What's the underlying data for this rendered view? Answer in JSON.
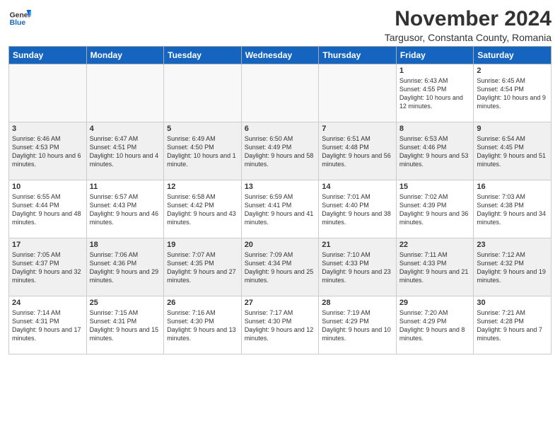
{
  "header": {
    "logo_general": "General",
    "logo_blue": "Blue",
    "month_title": "November 2024",
    "location": "Targusor, Constanta County, Romania"
  },
  "days_of_week": [
    "Sunday",
    "Monday",
    "Tuesday",
    "Wednesday",
    "Thursday",
    "Friday",
    "Saturday"
  ],
  "weeks": [
    [
      {
        "day": "",
        "info": ""
      },
      {
        "day": "",
        "info": ""
      },
      {
        "day": "",
        "info": ""
      },
      {
        "day": "",
        "info": ""
      },
      {
        "day": "",
        "info": ""
      },
      {
        "day": "1",
        "info": "Sunrise: 6:43 AM\nSunset: 4:55 PM\nDaylight: 10 hours and 12 minutes."
      },
      {
        "day": "2",
        "info": "Sunrise: 6:45 AM\nSunset: 4:54 PM\nDaylight: 10 hours and 9 minutes."
      }
    ],
    [
      {
        "day": "3",
        "info": "Sunrise: 6:46 AM\nSunset: 4:53 PM\nDaylight: 10 hours and 6 minutes."
      },
      {
        "day": "4",
        "info": "Sunrise: 6:47 AM\nSunset: 4:51 PM\nDaylight: 10 hours and 4 minutes."
      },
      {
        "day": "5",
        "info": "Sunrise: 6:49 AM\nSunset: 4:50 PM\nDaylight: 10 hours and 1 minute."
      },
      {
        "day": "6",
        "info": "Sunrise: 6:50 AM\nSunset: 4:49 PM\nDaylight: 9 hours and 58 minutes."
      },
      {
        "day": "7",
        "info": "Sunrise: 6:51 AM\nSunset: 4:48 PM\nDaylight: 9 hours and 56 minutes."
      },
      {
        "day": "8",
        "info": "Sunrise: 6:53 AM\nSunset: 4:46 PM\nDaylight: 9 hours and 53 minutes."
      },
      {
        "day": "9",
        "info": "Sunrise: 6:54 AM\nSunset: 4:45 PM\nDaylight: 9 hours and 51 minutes."
      }
    ],
    [
      {
        "day": "10",
        "info": "Sunrise: 6:55 AM\nSunset: 4:44 PM\nDaylight: 9 hours and 48 minutes."
      },
      {
        "day": "11",
        "info": "Sunrise: 6:57 AM\nSunset: 4:43 PM\nDaylight: 9 hours and 46 minutes."
      },
      {
        "day": "12",
        "info": "Sunrise: 6:58 AM\nSunset: 4:42 PM\nDaylight: 9 hours and 43 minutes."
      },
      {
        "day": "13",
        "info": "Sunrise: 6:59 AM\nSunset: 4:41 PM\nDaylight: 9 hours and 41 minutes."
      },
      {
        "day": "14",
        "info": "Sunrise: 7:01 AM\nSunset: 4:40 PM\nDaylight: 9 hours and 38 minutes."
      },
      {
        "day": "15",
        "info": "Sunrise: 7:02 AM\nSunset: 4:39 PM\nDaylight: 9 hours and 36 minutes."
      },
      {
        "day": "16",
        "info": "Sunrise: 7:03 AM\nSunset: 4:38 PM\nDaylight: 9 hours and 34 minutes."
      }
    ],
    [
      {
        "day": "17",
        "info": "Sunrise: 7:05 AM\nSunset: 4:37 PM\nDaylight: 9 hours and 32 minutes."
      },
      {
        "day": "18",
        "info": "Sunrise: 7:06 AM\nSunset: 4:36 PM\nDaylight: 9 hours and 29 minutes."
      },
      {
        "day": "19",
        "info": "Sunrise: 7:07 AM\nSunset: 4:35 PM\nDaylight: 9 hours and 27 minutes."
      },
      {
        "day": "20",
        "info": "Sunrise: 7:09 AM\nSunset: 4:34 PM\nDaylight: 9 hours and 25 minutes."
      },
      {
        "day": "21",
        "info": "Sunrise: 7:10 AM\nSunset: 4:33 PM\nDaylight: 9 hours and 23 minutes."
      },
      {
        "day": "22",
        "info": "Sunrise: 7:11 AM\nSunset: 4:33 PM\nDaylight: 9 hours and 21 minutes."
      },
      {
        "day": "23",
        "info": "Sunrise: 7:12 AM\nSunset: 4:32 PM\nDaylight: 9 hours and 19 minutes."
      }
    ],
    [
      {
        "day": "24",
        "info": "Sunrise: 7:14 AM\nSunset: 4:31 PM\nDaylight: 9 hours and 17 minutes."
      },
      {
        "day": "25",
        "info": "Sunrise: 7:15 AM\nSunset: 4:31 PM\nDaylight: 9 hours and 15 minutes."
      },
      {
        "day": "26",
        "info": "Sunrise: 7:16 AM\nSunset: 4:30 PM\nDaylight: 9 hours and 13 minutes."
      },
      {
        "day": "27",
        "info": "Sunrise: 7:17 AM\nSunset: 4:30 PM\nDaylight: 9 hours and 12 minutes."
      },
      {
        "day": "28",
        "info": "Sunrise: 7:19 AM\nSunset: 4:29 PM\nDaylight: 9 hours and 10 minutes."
      },
      {
        "day": "29",
        "info": "Sunrise: 7:20 AM\nSunset: 4:29 PM\nDaylight: 9 hours and 8 minutes."
      },
      {
        "day": "30",
        "info": "Sunrise: 7:21 AM\nSunset: 4:28 PM\nDaylight: 9 hours and 7 minutes."
      }
    ]
  ]
}
